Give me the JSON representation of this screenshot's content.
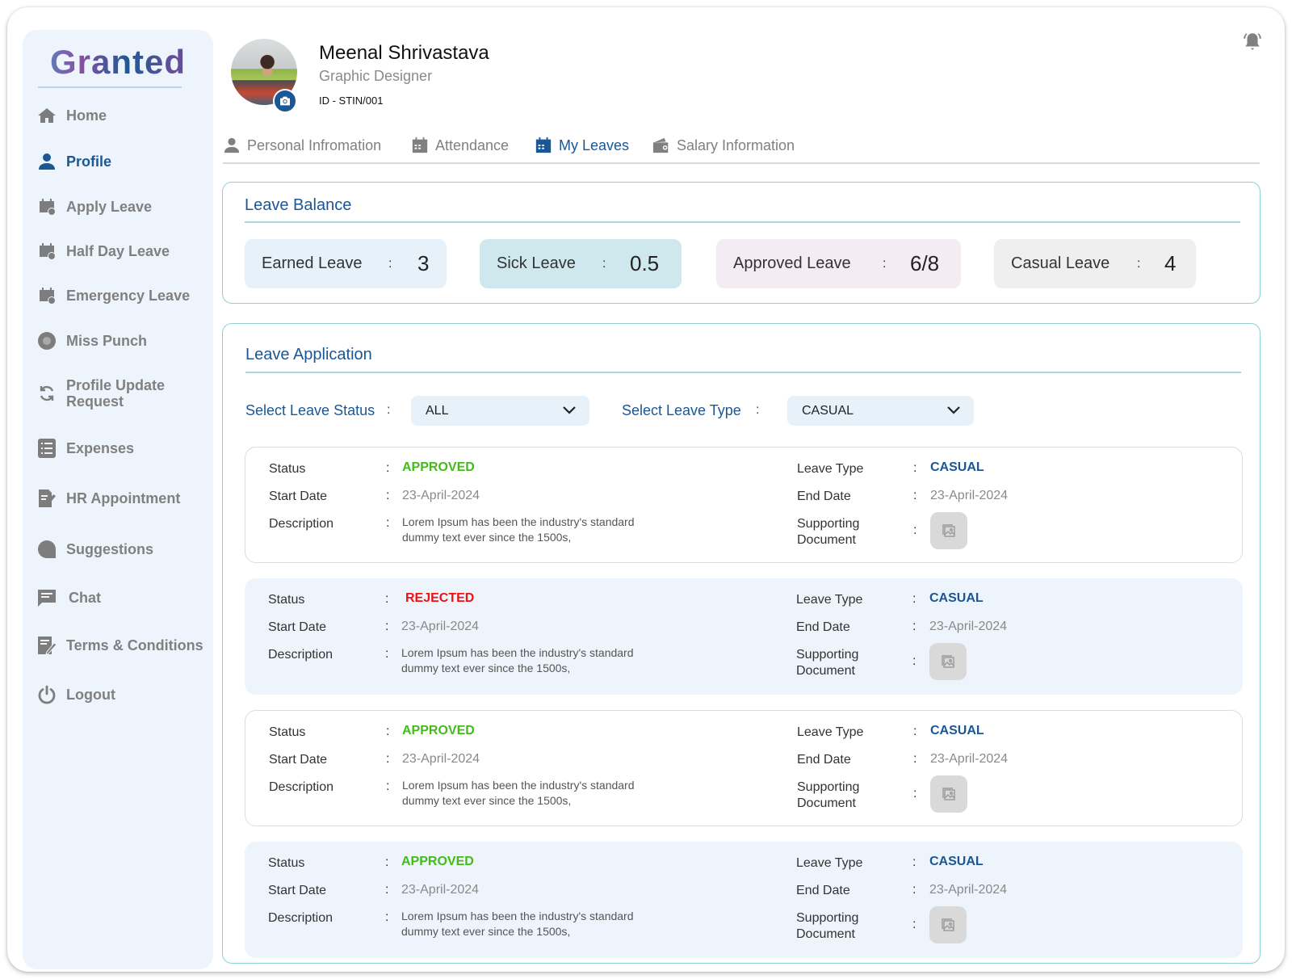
{
  "app": {
    "logo": "Granted"
  },
  "sidebar": {
    "items": [
      {
        "label": "Home",
        "icon": "home-icon",
        "active": false
      },
      {
        "label": "Profile",
        "icon": "user-icon",
        "active": true
      },
      {
        "label": "Apply Leave",
        "icon": "calendar-check-icon",
        "active": false
      },
      {
        "label": "Half Day Leave",
        "icon": "calendar-check-icon",
        "active": false
      },
      {
        "label": "Emergency Leave",
        "icon": "calendar-check-icon",
        "active": false
      },
      {
        "label": "Miss Punch",
        "icon": "fingerprint-icon",
        "active": false
      },
      {
        "label": "Profile Update Request",
        "icon": "refresh-icon",
        "active": false
      },
      {
        "label": "Expenses",
        "icon": "list-icon",
        "active": false
      },
      {
        "label": "HR Appointment",
        "icon": "document-edit-icon",
        "active": false
      },
      {
        "label": "Suggestions",
        "icon": "speech-bubble-icon",
        "active": false
      },
      {
        "label": "Chat",
        "icon": "chat-icon",
        "active": false
      },
      {
        "label": "Terms & Conditions",
        "icon": "terms-edit-icon",
        "active": false
      },
      {
        "label": "Logout",
        "icon": "power-icon",
        "active": false
      }
    ]
  },
  "profile": {
    "name": "Meenal Shrivastava",
    "role": "Graphic Designer",
    "id": "ID - STIN/001"
  },
  "tabs": [
    {
      "label": "Personal Infromation",
      "icon": "user-icon",
      "active": false
    },
    {
      "label": "Attendance",
      "icon": "calendar-icon",
      "active": false
    },
    {
      "label": "My Leaves",
      "icon": "calendar-icon",
      "active": true
    },
    {
      "label": "Salary Information",
      "icon": "wallet-icon",
      "active": false
    }
  ],
  "leave_balance": {
    "title": "Leave Balance",
    "separator": ":",
    "cards": [
      {
        "label": "Earned Leave",
        "value": "3",
        "color": "#e7f1fa"
      },
      {
        "label": "Sick Leave",
        "value": "0.5",
        "color": "#cfe8ed"
      },
      {
        "label": "Approved Leave",
        "value": "6/8",
        "color": "#f5ebf3"
      },
      {
        "label": "Casual Leave",
        "value": "4",
        "color": "#efefef"
      }
    ]
  },
  "leave_application": {
    "title": "Leave Application",
    "filters": {
      "status_label": "Select Leave Status",
      "status_value": "ALL",
      "type_label": "Select Leave Type",
      "type_value": "CASUAL",
      "separator": ":"
    },
    "field_labels": {
      "status": "Status",
      "start_date": "Start Date",
      "description": "Description",
      "leave_type": "Leave Type",
      "end_date": "End Date",
      "supporting_document": "Supporting Document",
      "separator": ":"
    },
    "applications": [
      {
        "status": "APPROVED",
        "start_date": "23-April-2024",
        "description": "Lorem Ipsum has been the industry's standard dummy text ever since the 1500s,",
        "leave_type": "CASUAL",
        "end_date": "23-April-2024"
      },
      {
        "status": "REJECTED",
        "start_date": "23-April-2024",
        "description": "Lorem Ipsum has been the industry's standard dummy text ever since the 1500s,",
        "leave_type": "CASUAL",
        "end_date": "23-April-2024"
      },
      {
        "status": "APPROVED",
        "start_date": "23-April-2024",
        "description": "Lorem Ipsum has been the industry's standard dummy text ever since the 1500s,",
        "leave_type": "CASUAL",
        "end_date": "23-April-2024"
      },
      {
        "status": "APPROVED",
        "start_date": "23-April-2024",
        "description": "Lorem Ipsum has been the industry's standard dummy text ever since the 1500s,",
        "leave_type": "CASUAL",
        "end_date": "23-April-2024"
      }
    ]
  },
  "colors": {
    "accent": "#1a5794",
    "approved": "#44bb19",
    "rejected": "#ee1111",
    "sidebar_bg": "#edf4fb",
    "panel_border": "#8fcfd6"
  }
}
